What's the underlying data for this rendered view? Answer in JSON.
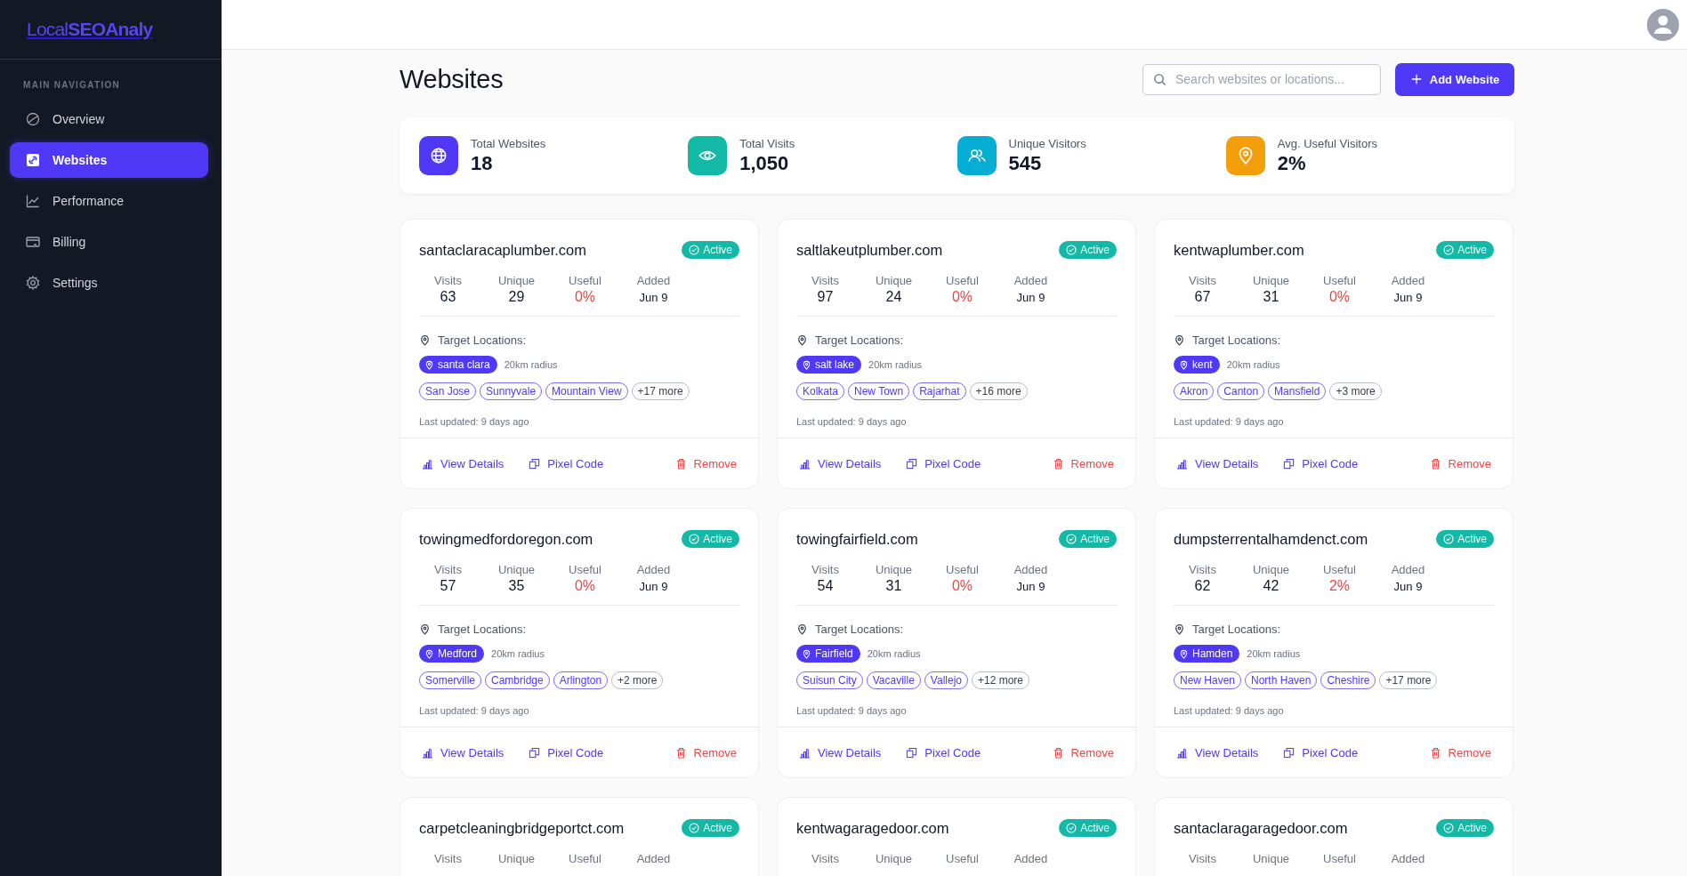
{
  "logo": "Local**SEOAnaly**",
  "sidebar": {
    "heading": "MAIN NAVIGATION",
    "items": [
      {
        "label": "Overview",
        "selected": false
      },
      {
        "label": "Websites",
        "selected": true
      },
      {
        "label": "Performance",
        "selected": false
      },
      {
        "label": "Billing",
        "selected": false
      },
      {
        "label": "Settings",
        "selected": false
      }
    ]
  },
  "page_title": "Websites",
  "search": {
    "placeholder": "Search websites or locations..."
  },
  "add_button": "Add Website",
  "stats": [
    {
      "label": "Total Websites",
      "value": "18",
      "color": "#4f39f6"
    },
    {
      "label": "Total Visits",
      "value": "1,050",
      "color": "#14b8a6"
    },
    {
      "label": "Unique Visitors",
      "value": "545",
      "color": "#06aed4"
    },
    {
      "label": "Avg. Useful Visitors",
      "value": "2%",
      "color": "#f59e0b"
    }
  ],
  "sites": [
    {
      "domain": "santaclaracaplumber.com",
      "status": "Active",
      "stats": [
        {
          "label": "Visits",
          "value": "63"
        },
        {
          "label": "Unique",
          "value": "29"
        },
        {
          "label": "Useful",
          "value": "0%"
        },
        {
          "label": "Added",
          "value": "Jun 9"
        }
      ],
      "locations_label": "Target Locations:",
      "primary": "santa clara",
      "radius": "20km radius",
      "nearby": [
        "San Jose",
        "Sunnyvale",
        "Mountain View"
      ],
      "more": "+17 more",
      "updated": "Last updated: 9 days ago",
      "actions": [
        "View Details",
        "Pixel Code",
        "Remove"
      ]
    },
    {
      "domain": "saltlakeutplumber.com",
      "status": "Active",
      "stats": [
        {
          "label": "Visits",
          "value": "97"
        },
        {
          "label": "Unique",
          "value": "24"
        },
        {
          "label": "Useful",
          "value": "0%"
        },
        {
          "label": "Added",
          "value": "Jun 9"
        }
      ],
      "locations_label": "Target Locations:",
      "primary": "salt lake",
      "radius": "20km radius",
      "nearby": [
        "Kolkata",
        "New Town",
        "Rajarhat"
      ],
      "more": "+16 more",
      "updated": "Last updated: 9 days ago",
      "actions": [
        "View Details",
        "Pixel Code",
        "Remove"
      ]
    },
    {
      "domain": "kentwaplumber.com",
      "status": "Active",
      "stats": [
        {
          "label": "Visits",
          "value": "67"
        },
        {
          "label": "Unique",
          "value": "31"
        },
        {
          "label": "Useful",
          "value": "0%"
        },
        {
          "label": "Added",
          "value": "Jun 9"
        }
      ],
      "locations_label": "Target Locations:",
      "primary": "kent",
      "radius": "20km radius",
      "nearby": [
        "Akron",
        "Canton",
        "Mansfield"
      ],
      "more": "+3 more",
      "updated": "Last updated: 9 days ago",
      "actions": [
        "View Details",
        "Pixel Code",
        "Remove"
      ]
    },
    {
      "domain": "towingmedfordoregon.com",
      "status": "Active",
      "stats": [
        {
          "label": "Visits",
          "value": "57"
        },
        {
          "label": "Unique",
          "value": "35"
        },
        {
          "label": "Useful",
          "value": "0%"
        },
        {
          "label": "Added",
          "value": "Jun 9"
        }
      ],
      "locations_label": "Target Locations:",
      "primary": "Medford",
      "radius": "20km radius",
      "nearby": [
        "Somerville",
        "Cambridge",
        "Arlington"
      ],
      "more": "+2 more",
      "updated": "Last updated: 9 days ago",
      "actions": [
        "View Details",
        "Pixel Code",
        "Remove"
      ]
    },
    {
      "domain": "towingfairfield.com",
      "status": "Active",
      "stats": [
        {
          "label": "Visits",
          "value": "54"
        },
        {
          "label": "Unique",
          "value": "31"
        },
        {
          "label": "Useful",
          "value": "0%"
        },
        {
          "label": "Added",
          "value": "Jun 9"
        }
      ],
      "locations_label": "Target Locations:",
      "primary": "Fairfield",
      "radius": "20km radius",
      "nearby": [
        "Suisun City",
        "Vacaville",
        "Vallejo"
      ],
      "more": "+12 more",
      "updated": "Last updated: 9 days ago",
      "actions": [
        "View Details",
        "Pixel Code",
        "Remove"
      ]
    },
    {
      "domain": "dumpsterrentalhamdenct.com",
      "status": "Active",
      "stats": [
        {
          "label": "Visits",
          "value": "62"
        },
        {
          "label": "Unique",
          "value": "42"
        },
        {
          "label": "Useful",
          "value": "2%"
        },
        {
          "label": "Added",
          "value": "Jun 9"
        }
      ],
      "locations_label": "Target Locations:",
      "primary": "Hamden",
      "radius": "20km radius",
      "nearby": [
        "New Haven",
        "North Haven",
        "Cheshire"
      ],
      "more": "+17 more",
      "updated": "Last updated: 9 days ago",
      "actions": [
        "View Details",
        "Pixel Code",
        "Remove"
      ]
    },
    {
      "domain": "carpetcleaningbridgeportct.com",
      "status": "Active",
      "stats": [
        {
          "label": "Visits"
        },
        {
          "label": "Unique"
        },
        {
          "label": "Useful"
        },
        {
          "label": "Added"
        }
      ]
    },
    {
      "domain": "kentwagaragedoor.com",
      "status": "Active",
      "stats": [
        {
          "label": "Visits"
        },
        {
          "label": "Unique"
        },
        {
          "label": "Useful"
        },
        {
          "label": "Added"
        }
      ]
    },
    {
      "domain": "santaclaragaragedoor.com",
      "status": "Active",
      "stats": [
        {
          "label": "Visits"
        },
        {
          "label": "Unique"
        },
        {
          "label": "Useful"
        },
        {
          "label": "Added"
        }
      ]
    }
  ]
}
